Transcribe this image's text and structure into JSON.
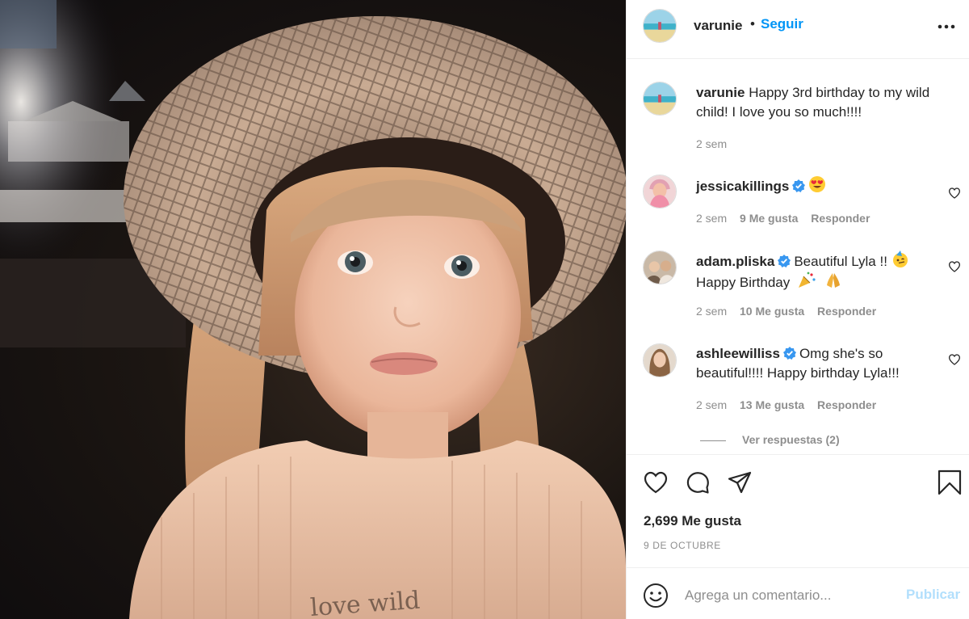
{
  "header": {
    "username": "varunie",
    "separator": "•",
    "follow_label": "Seguir"
  },
  "caption": {
    "username": "varunie",
    "text": "Happy 3rd birthday to my wild child! I love you so much!!!!",
    "time": "2 sem"
  },
  "comments": [
    {
      "username": "jessicakillings",
      "verified": true,
      "text": "",
      "emoji": "heart-eyes",
      "time": "2 sem",
      "likes": "9 Me gusta",
      "reply_label": "Responder"
    },
    {
      "username": "adam.pliska",
      "verified": true,
      "text": "Beautiful Lyla !!",
      "text2": "Happy Birthday",
      "emojis": [
        "party-face",
        "party-popper",
        "folded-hands"
      ],
      "time": "2 sem",
      "likes": "10 Me gusta",
      "reply_label": "Responder"
    },
    {
      "username": "ashleewilliss",
      "verified": true,
      "text": "Omg she's so beautiful!!!! Happy birthday Lyla!!!",
      "time": "2 sem",
      "likes": "13 Me gusta",
      "reply_label": "Responder"
    }
  ],
  "view_replies": "Ver respuestas (2)",
  "actions": {
    "icons": [
      "heart-icon",
      "comment-icon",
      "share-icon",
      "bookmark-icon"
    ],
    "likes_count": "2,699 Me gusta",
    "date": "9 DE OCTUBRE"
  },
  "add_comment": {
    "placeholder": "Agrega un comentario...",
    "publish_label": "Publicar"
  },
  "colors": {
    "link_blue": "#0095f6",
    "publish_disabled": "#b2dffc",
    "verified_blue": "#3897f0",
    "text_primary": "#262626",
    "text_secondary": "#8e8e8e"
  }
}
